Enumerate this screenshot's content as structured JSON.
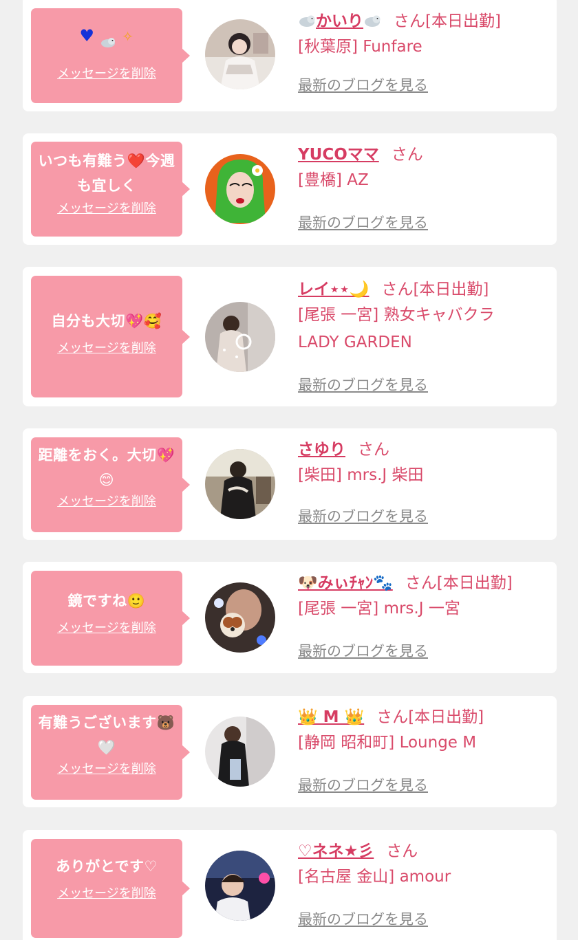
{
  "actions": {
    "delete_message": "メッセージを削除",
    "latest_blog": "最新のブログを見る"
  },
  "honorific": "さん",
  "on_duty": "[本日出勤]",
  "items": [
    {
      "message": "",
      "message_emoji": "blue-heart seal sparkle",
      "name": "かいり",
      "name_emoji": "seal",
      "on_duty": true,
      "shop": "[秋葉原] Funfare"
    },
    {
      "message": "いつも有難う❤️今週も宜しく",
      "name": "YUCOママ",
      "on_duty": false,
      "shop": "[豊橋] AZ"
    },
    {
      "message": "自分も大切💖🥰",
      "name": "レイ⋆⋆🌙",
      "on_duty": true,
      "shop": "[尾張 一宮] 熟女キャバクラ LADY GARDEN"
    },
    {
      "message": "距離をおく。大切💖😊",
      "name": "さゆり",
      "on_duty": false,
      "shop": "[柴田] mrs.J 柴田"
    },
    {
      "message": "鏡ですね🙂",
      "name": "🐶みぃﾁｬﾝ🐾",
      "on_duty": true,
      "shop": "[尾張 一宮] mrs.J 一宮"
    },
    {
      "message": "有難うございます🐻🤍",
      "name": "👑 M 👑",
      "on_duty": true,
      "shop": "[静岡 昭和町] Lounge M"
    },
    {
      "message": "ありがとです♡",
      "name": "♡ネネ★彡",
      "on_duty": false,
      "shop": "[名古屋 金山] amour"
    }
  ],
  "colors": {
    "bubble": "#f79aa8",
    "name": "#d63c62",
    "shop": "#d94a6a",
    "blog_link": "#8a8a8a",
    "background": "#f0f0f0"
  }
}
